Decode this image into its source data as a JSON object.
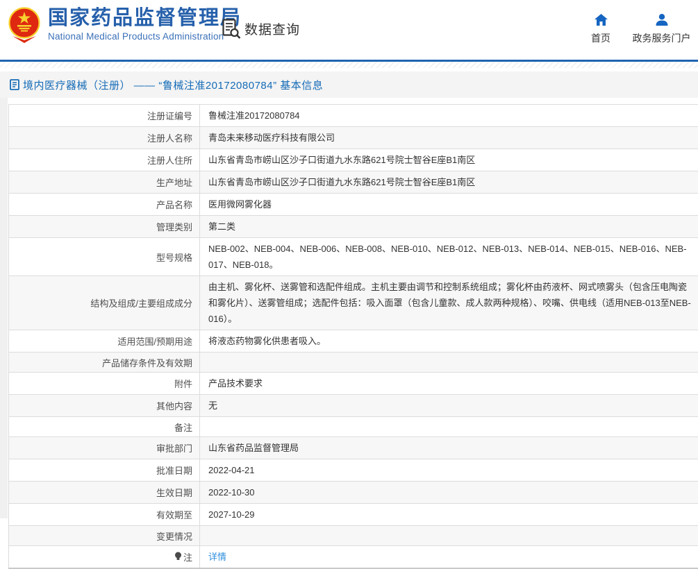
{
  "header": {
    "org_name_cn": "国家药品监督管理局",
    "org_name_en": "National Medical Products Administration",
    "data_query_label": "数据查询",
    "nav_home_label": "首页",
    "nav_portal_label": "政务服务门户"
  },
  "breadcrumb": {
    "text": "境内医疗器械（注册） —— “鲁械注准20172080784” 基本信息"
  },
  "table": {
    "rows": [
      {
        "label": "注册证编号",
        "value": "鲁械注准20172080784"
      },
      {
        "label": "注册人名称",
        "value": "青岛未来移动医疗科技有限公司"
      },
      {
        "label": "注册人住所",
        "value": "山东省青岛市崂山区沙子口街道九水东路621号院士智谷E座B1南区"
      },
      {
        "label": "生产地址",
        "value": "山东省青岛市崂山区沙子口街道九水东路621号院士智谷E座B1南区"
      },
      {
        "label": "产品名称",
        "value": "医用微网雾化器"
      },
      {
        "label": "管理类别",
        "value": "第二类"
      },
      {
        "label": "型号规格",
        "value": "NEB-002、NEB-004、NEB-006、NEB-008、NEB-010、NEB-012、NEB-013、NEB-014、NEB-015、NEB-016、NEB-017、NEB-018。"
      },
      {
        "label": "结构及组成/主要组成成分",
        "value": "由主机、雾化杯、送雾管和选配件组成。主机主要由调节和控制系统组成；雾化杯由药液杯、网式喷雾头（包含压电陶瓷和雾化片）、送雾管组成；选配件包括：吸入面罩（包含儿童款、成人款两种规格）、咬嘴、供电线（适用NEB-013至NEB-016）。"
      },
      {
        "label": "适用范围/预期用途",
        "value": "将液态药物雾化供患者吸入。"
      },
      {
        "label": "产品储存条件及有效期",
        "value": ""
      },
      {
        "label": "附件",
        "value": "产品技术要求"
      },
      {
        "label": "其他内容",
        "value": "无"
      },
      {
        "label": "备注",
        "value": ""
      },
      {
        "label": "审批部门",
        "value": "山东省药品监督管理局"
      },
      {
        "label": "批准日期",
        "value": "2022-04-21"
      },
      {
        "label": "生效日期",
        "value": "2022-10-30"
      },
      {
        "label": "有效期至",
        "value": "2027-10-29"
      },
      {
        "label": "变更情况",
        "value": ""
      },
      {
        "label": "注",
        "value": "详情"
      }
    ]
  },
  "colors": {
    "brand_blue": "#2660ab",
    "nav_icon_blue": "#1565c1",
    "divider_blue": "#1f64b0",
    "breadcrumb_text": "#156bb7",
    "link_blue": "#2f8fdd",
    "emblem_red": "#de2910",
    "emblem_gold": "#f8d12e",
    "row_alt_bg": "#f7f7f7",
    "border_gray": "#dcdcdc"
  }
}
